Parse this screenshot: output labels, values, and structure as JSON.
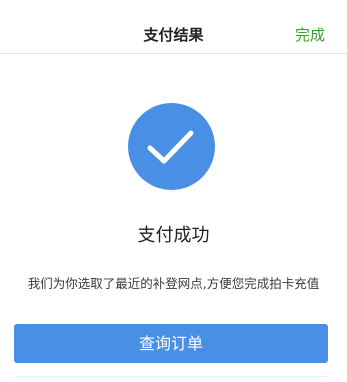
{
  "header": {
    "title": "支付结果",
    "done_label": "完成"
  },
  "result": {
    "icon": "checkmark-icon",
    "status_text": "支付成功",
    "description": "我们为你选取了最近的补登网点,方便您完成拍卡充值"
  },
  "actions": {
    "query_order_label": "查询订单"
  },
  "colors": {
    "accent": "#4a8fe6",
    "done_green": "#2fa52f"
  }
}
